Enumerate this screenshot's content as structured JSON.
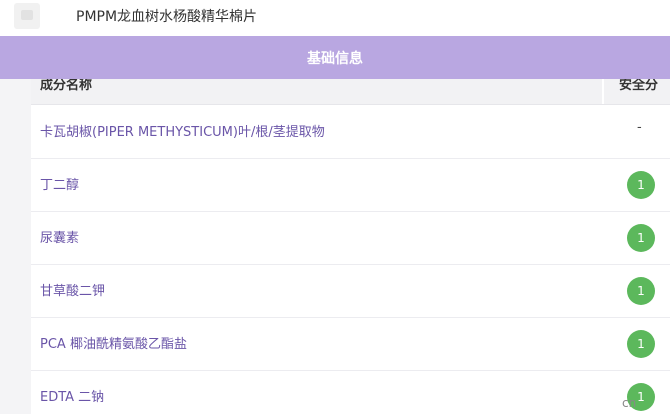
{
  "header": {
    "product_title": "PMPM龙血树水杨酸精华棉片"
  },
  "banner": {
    "label": "基础信息"
  },
  "table": {
    "columns": {
      "name": "成分名称",
      "score": "安全分"
    },
    "rows": [
      {
        "name": "卡瓦胡椒(PIPER METHYSTICUM)叶/根/茎提取物",
        "score": "-"
      },
      {
        "name": "丁二醇",
        "score": "1"
      },
      {
        "name": "尿囊素",
        "score": "1"
      },
      {
        "name": "甘草酸二钾",
        "score": "1"
      },
      {
        "name": "PCA 椰油酰精氨酸乙酯盐",
        "score": "1"
      },
      {
        "name": "EDTA 二钠",
        "score": "1"
      }
    ]
  },
  "watermark": {
    "text": "cn"
  },
  "colors": {
    "banner": "#b9a7e1",
    "link": "#6a55a8",
    "badge": "#5cb85c"
  }
}
